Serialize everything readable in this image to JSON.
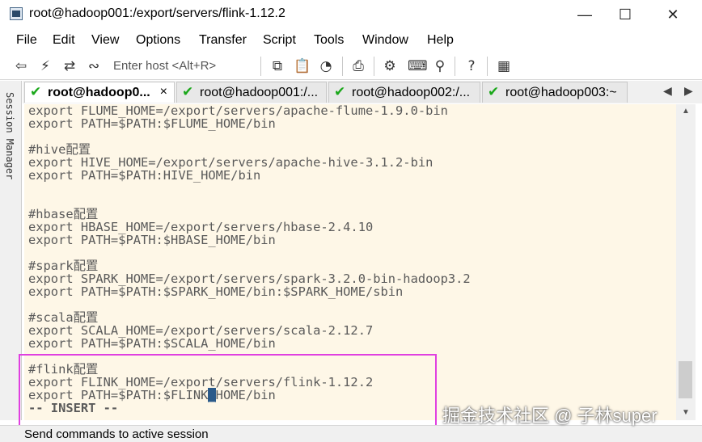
{
  "window": {
    "title": "root@hadoop001:/export/servers/flink-1.12.2",
    "minimize_glyph": "—",
    "maximize_glyph": "☐",
    "close_glyph": "✕"
  },
  "menu": [
    "File",
    "Edit",
    "View",
    "Options",
    "Transfer",
    "Script",
    "Tools",
    "Window",
    "Help"
  ],
  "toolbar": {
    "enter_host_placeholder": "Enter host <Alt+R>",
    "icons": [
      "connect-icon",
      "quick-connect-icon",
      "reconnect-icon",
      "disconnect-icon",
      "copy-icon",
      "paste-icon",
      "find-icon",
      "print-icon",
      "settings-icon",
      "keymap-icon",
      "key-icon",
      "help-icon",
      "sftp-icon"
    ]
  },
  "session_manager": {
    "label": "Session Manager"
  },
  "tabs": [
    {
      "label": "root@hadoop0...",
      "active": true
    },
    {
      "label": "root@hadoop001:/...",
      "active": false
    },
    {
      "label": "root@hadoop002:/...",
      "active": false
    },
    {
      "label": "root@hadoop003:~",
      "active": false
    }
  ],
  "tab_close_glyph": "×",
  "tab_nav": {
    "left": "◀",
    "right": "▶"
  },
  "terminal": {
    "lines": [
      "export FLUME_HOME=/export/servers/apache-flume-1.9.0-bin",
      "export PATH=$PATH:$FLUME_HOME/bin",
      "",
      "#hive配置",
      "export HIVE_HOME=/export/servers/apache-hive-3.1.2-bin",
      "export PATH=$PATH:HIVE_HOME/bin",
      "",
      "",
      "#hbase配置",
      "export HBASE_HOME=/export/servers/hbase-2.4.10",
      "export PATH=$PATH:$HBASE_HOME/bin",
      "",
      "#spark配置",
      "export SPARK_HOME=/export/servers/spark-3.2.0-bin-hadoop3.2",
      "export PATH=$PATH:$SPARK_HOME/bin:$SPARK_HOME/sbin",
      "",
      "#scala配置",
      "export SCALA_HOME=/export/servers/scala-2.12.7",
      "export PATH=$PATH:$SCALA_HOME/bin",
      "",
      "#flink配置",
      "export FLINK_HOME=/export/servers/flink-1.12.2"
    ],
    "cursor_line": {
      "before": "export PATH=$PATH:$FLINK",
      "cursor": "_",
      "after": "HOME/bin"
    },
    "mode_line": "-- INSERT --"
  },
  "status_bar": {
    "text": "Send commands to active session"
  },
  "watermark": "掘金技术社区 @ 子林super"
}
